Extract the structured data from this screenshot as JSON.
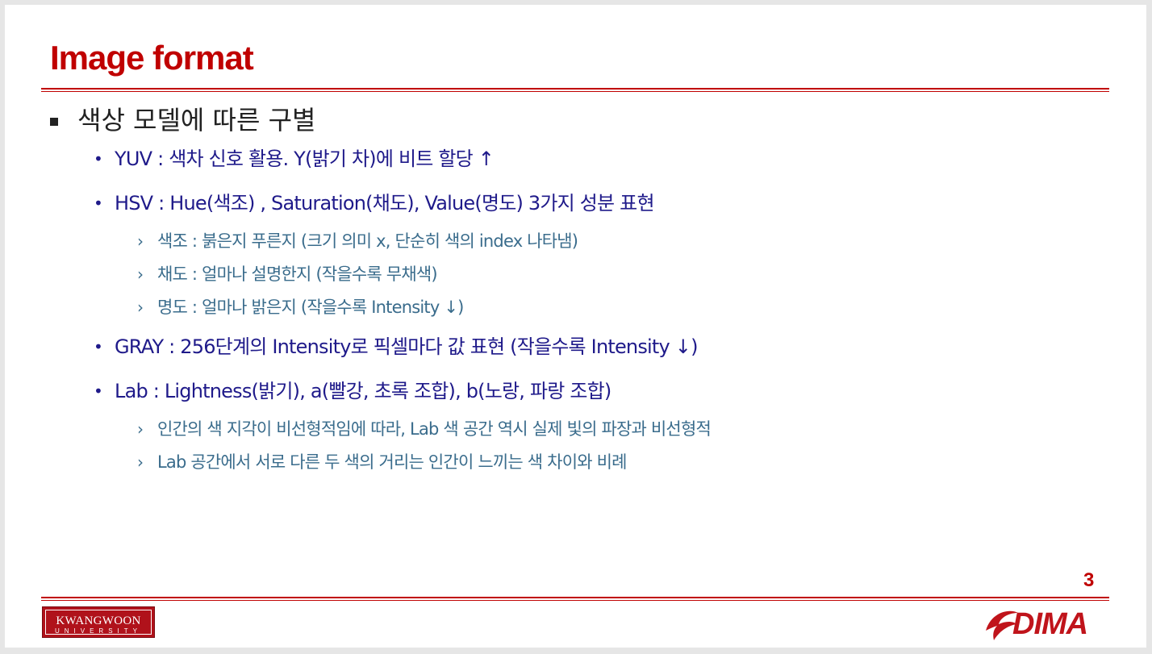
{
  "slide": {
    "title": "Image format",
    "page_number": "3",
    "heading": "색상 모델에 따른 구별",
    "items": [
      {
        "text": "YUV : 색차 신호 활용. Y(밝기 차)에 비트 할당 ↑"
      },
      {
        "text": "HSV : Hue(색조) , Saturation(채도), Value(명도) 3가지 성분 표현",
        "sub": [
          "색조 : 붉은지 푸른지 (크기 의미 x, 단순히 색의 index 나타냄)",
          "채도 : 얼마나 설명한지 (작을수록 무채색)",
          "명도 : 얼마나 밝은지 (작을수록 Intensity ↓)"
        ]
      },
      {
        "text": "GRAY : 256단계의 Intensity로 픽셀마다 값 표현 (작을수록 Intensity ↓)"
      },
      {
        "text": "Lab : Lightness(밝기), a(빨강, 초록 조합), b(노랑, 파랑 조합)",
        "sub": [
          "인간의 색 지각이 비선형적임에 따라, Lab 색 공간 역시 실제 빛의 파장과 비선형적",
          "Lab 공간에서 서로 다른 두 색의 거리는 인간이 느끼는 색 차이와 비례"
        ]
      }
    ]
  },
  "footer": {
    "university_logo_main": "KWANGWOON",
    "university_logo_sub": "UNIVERSITY",
    "lab_logo": "DIMA"
  },
  "colors": {
    "accent": "#c00000",
    "level2_text": "#1f1a8a",
    "level3_text": "#3a6c8c",
    "body_text": "#222222"
  },
  "icons": {
    "level1_bullet": "square-bullet-icon",
    "level2_bullet": "dot-bullet-icon",
    "level3_bullet": "chevron-right-icon",
    "lab_logo_mark": "swirl-icon"
  }
}
